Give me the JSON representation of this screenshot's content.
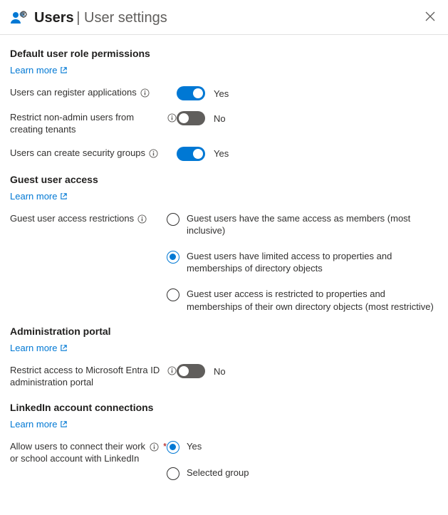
{
  "header": {
    "title": "Users",
    "subtitle": "User settings"
  },
  "sections": {
    "defaultRole": {
      "title": "Default user role permissions",
      "learn": "Learn more",
      "registerApps": {
        "label": "Users can register applications",
        "value": "Yes",
        "on": true
      },
      "restrictTenants": {
        "label": "Restrict non-admin users from creating tenants",
        "value": "No",
        "on": false
      },
      "securityGroups": {
        "label": "Users can create security groups",
        "value": "Yes",
        "on": true
      }
    },
    "guestAccess": {
      "title": "Guest user access",
      "learn": "Learn more",
      "label": "Guest user access restrictions",
      "options": [
        "Guest users have the same access as members (most inclusive)",
        "Guest users have limited access to properties and memberships of directory objects",
        "Guest user access is restricted to properties and memberships of their own directory objects (most restrictive)"
      ],
      "selected": 1
    },
    "adminPortal": {
      "title": "Administration portal",
      "learn": "Learn more",
      "restrict": {
        "label": "Restrict access to Microsoft Entra ID administration portal",
        "value": "No",
        "on": false
      }
    },
    "linkedin": {
      "title": "LinkedIn account connections",
      "learn": "Learn more",
      "label": "Allow users to connect their work or school account with LinkedIn",
      "options": [
        "Yes",
        "Selected group"
      ],
      "selected": 0
    }
  }
}
